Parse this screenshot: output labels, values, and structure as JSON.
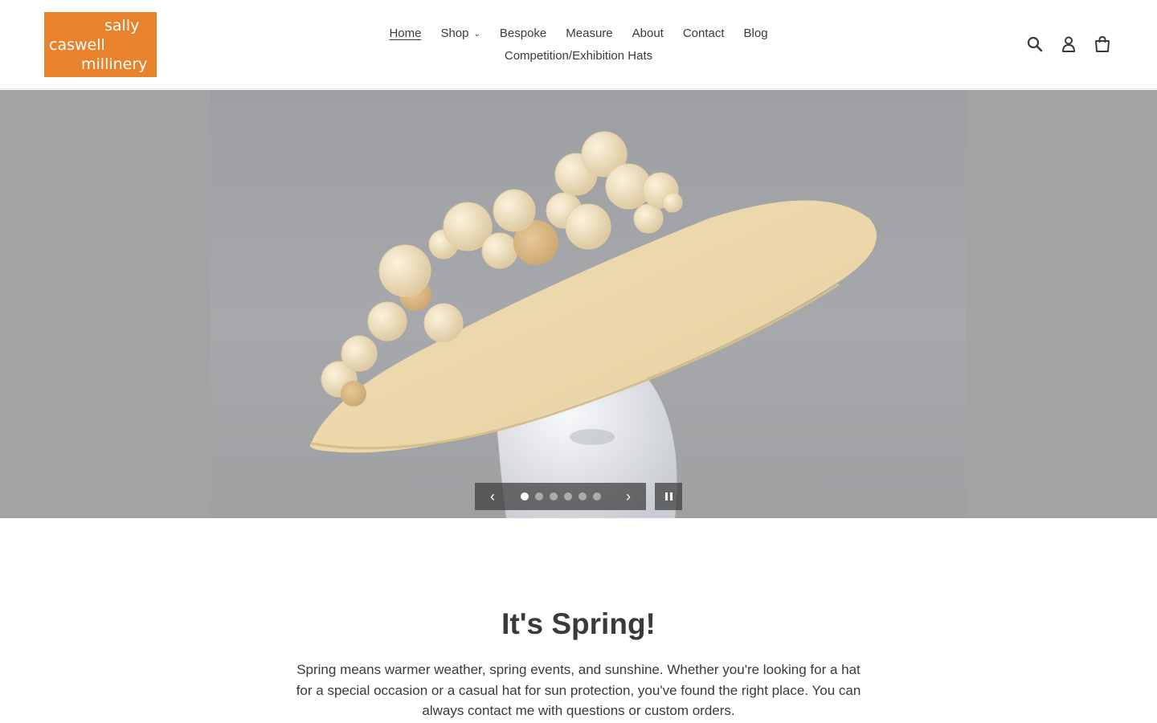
{
  "logo": {
    "line1": "sally",
    "line2": "caswell",
    "line3": "millinery",
    "color": "#e8822c"
  },
  "nav": {
    "items": [
      {
        "label": "Home",
        "active": true
      },
      {
        "label": "Shop",
        "dropdown": true
      },
      {
        "label": "Bespoke"
      },
      {
        "label": "Measure"
      },
      {
        "label": "About"
      },
      {
        "label": "Contact"
      },
      {
        "label": "Blog"
      }
    ],
    "second_row": {
      "label": "Competition/Exhibition Hats"
    }
  },
  "header_icons": [
    "search-icon",
    "account-icon",
    "cart-icon"
  ],
  "slideshow": {
    "slide_count": 6,
    "active_slide": 1,
    "prev_glyph": "‹",
    "next_glyph": "›"
  },
  "section": {
    "title": "It's Spring!",
    "body": "Spring means warmer weather, spring events, and sunshine. Whether you're looking for a hat for a special occasion or a casual hat for sun protection, you've found the right place. You can always contact me with questions or custom orders."
  }
}
